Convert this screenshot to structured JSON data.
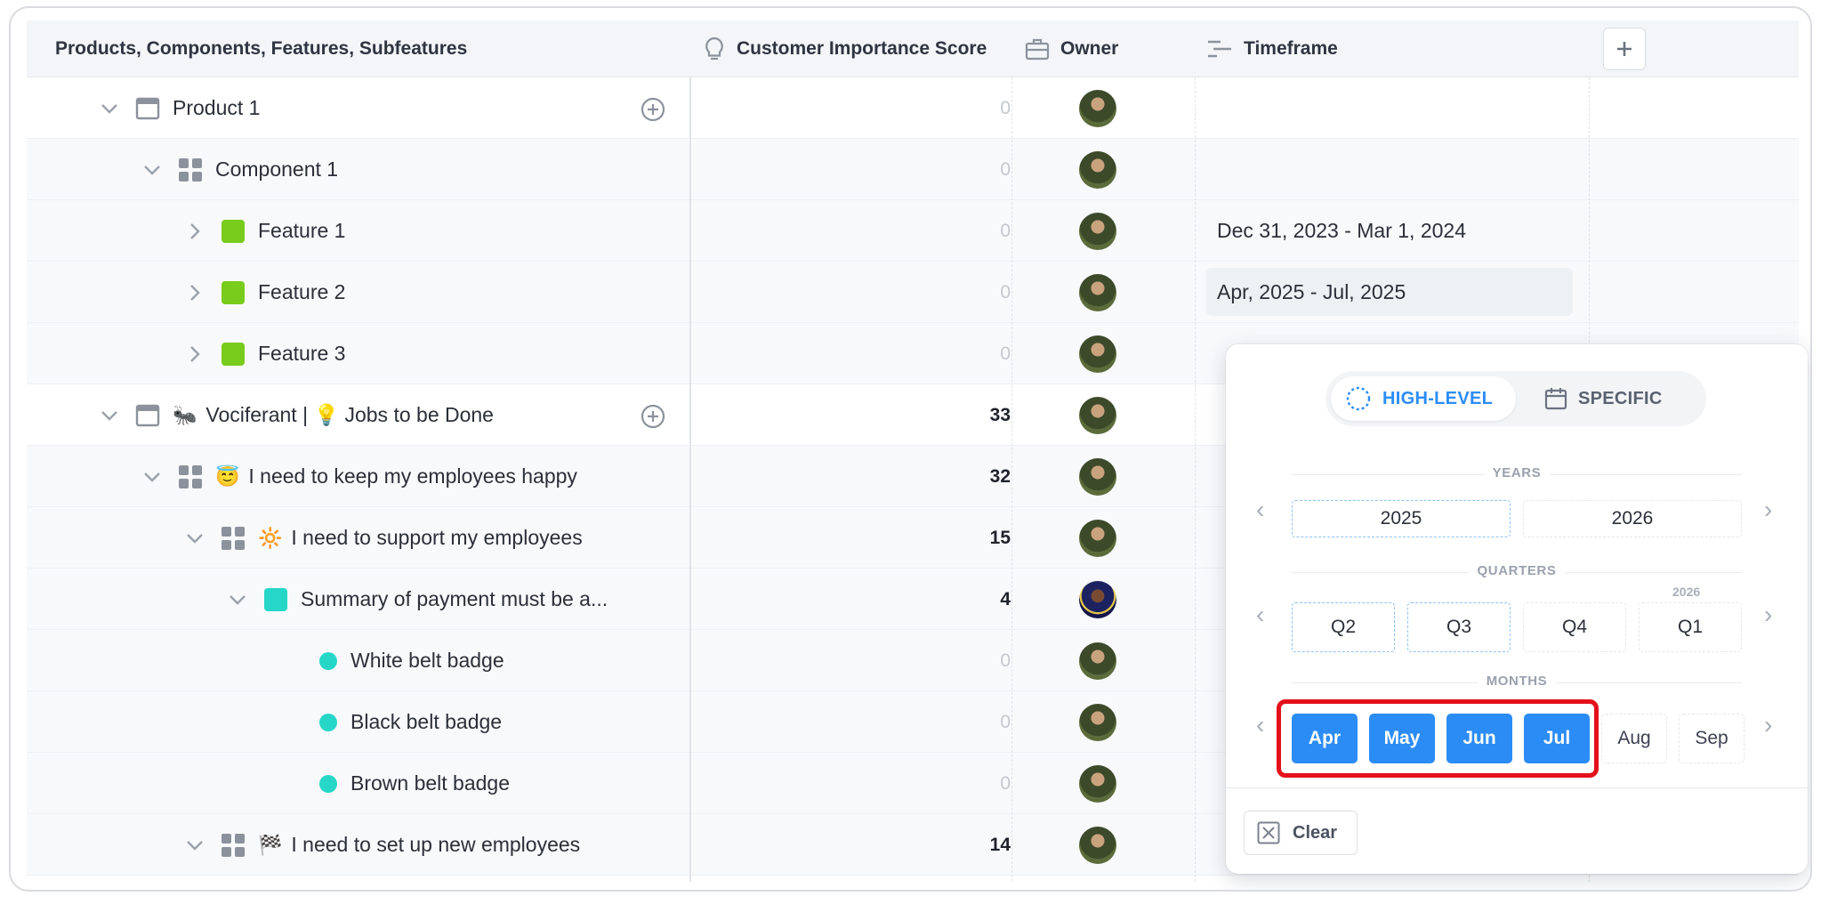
{
  "header": {
    "col_name": "Products, Components, Features, Subfeatures",
    "col_score": "Customer Importance Score",
    "col_owner": "Owner",
    "col_timeframe": "Timeframe",
    "add_column": "+"
  },
  "rows": [
    {
      "name": "Product 1",
      "emoji": "",
      "score": "0",
      "timeframe": ""
    },
    {
      "name": "Component 1",
      "emoji": "",
      "score": "0",
      "timeframe": ""
    },
    {
      "name": "Feature 1",
      "emoji": "",
      "score": "0",
      "timeframe": "Dec 31, 2023 - Mar 1, 2024"
    },
    {
      "name": "Feature 2",
      "emoji": "",
      "score": "0",
      "timeframe": "Apr, 2025 - Jul, 2025"
    },
    {
      "name": "Feature 3",
      "emoji": "",
      "score": "0",
      "timeframe": ""
    },
    {
      "name": "Vociferant | 💡 Jobs to be Done",
      "emoji": "🐜",
      "score": "33",
      "timeframe": ""
    },
    {
      "name": "I need to keep my employees happy",
      "emoji": "😇",
      "score": "32",
      "timeframe": ""
    },
    {
      "name": "I need to support my employees",
      "emoji": "🔆",
      "score": "15",
      "timeframe": ""
    },
    {
      "name": "Summary of payment must be a...",
      "emoji": "",
      "score": "4",
      "timeframe": ""
    },
    {
      "name": "White belt badge",
      "emoji": "",
      "score": "0",
      "timeframe": ""
    },
    {
      "name": "Black belt badge",
      "emoji": "",
      "score": "0",
      "timeframe": ""
    },
    {
      "name": "Brown belt badge",
      "emoji": "",
      "score": "0",
      "timeframe": ""
    },
    {
      "name": "I need to set up new employees",
      "emoji": "🏁",
      "score": "14",
      "timeframe": ""
    }
  ],
  "picker": {
    "mode_high_level": "HIGH-LEVEL",
    "mode_specific": "SPECIFIC",
    "years_label": "YEARS",
    "years": [
      "2025",
      "2026"
    ],
    "quarters_label": "QUARTERS",
    "quarters": [
      "Q2",
      "Q3",
      "Q4",
      "Q1"
    ],
    "quarter_year_hint": "2026",
    "months_label": "MONTHS",
    "months": [
      "Apr",
      "May",
      "Jun",
      "Jul",
      "Aug",
      "Sep"
    ],
    "clear_label": "Clear",
    "nav_prev": "‹",
    "nav_next": "›",
    "accent": "#2b8cf5",
    "highlight_color": "#e3101b"
  }
}
